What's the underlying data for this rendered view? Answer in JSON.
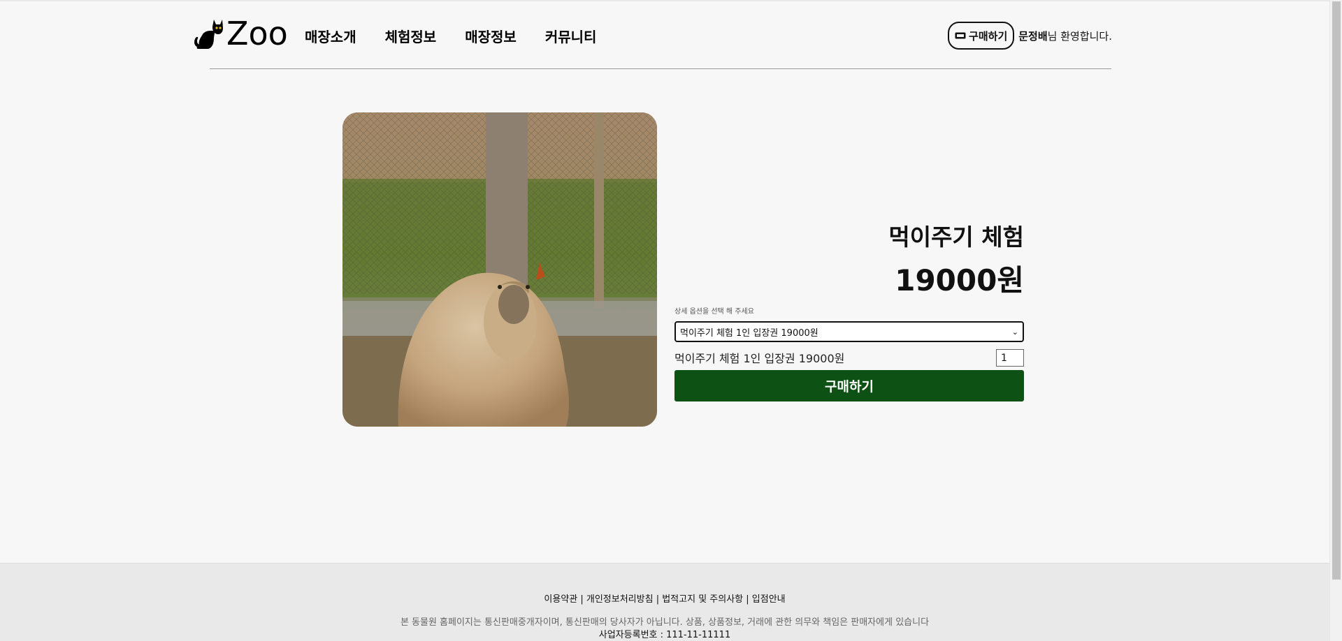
{
  "header": {
    "logo_text": "Zoo",
    "nav": [
      "매장소개",
      "체험정보",
      "매장정보",
      "커뮤니티"
    ],
    "buy_pill_label": "구매하기",
    "user_name": "문정배",
    "welcome_suffix": "님 환영합니다."
  },
  "product": {
    "title": "먹이주기 체험",
    "price": "19000원",
    "option_label": "상세 옵션을 선택 해 주세요",
    "selected_option": "먹이주기 체험 1인 입장권 19000원",
    "selected_line": "먹이주기 체험 1인 입장권 19000원",
    "quantity": "1",
    "buy_button": "구매하기"
  },
  "footer": {
    "links": [
      "이용약관",
      "개인정보처리방침",
      "법적고지 및 주의사항",
      "입점안내"
    ],
    "notice": "본 동물원 홈페이지는 통신판매중개자이며, 통신판매의 당사자가 아닙니다. 상품, 상품정보, 거래에 관한 의무와 책임은 판매자에게 있습니다",
    "biz_number": "사업자등록번호 : 111-11-11111"
  },
  "colors": {
    "buy_button": "#0e5114",
    "background": "#f7f7f7",
    "footer": "#e9e9e9"
  },
  "icons": {
    "logo": "cat-icon",
    "buy_pill": "ticket-icon",
    "select": "chevron-down-icon"
  }
}
